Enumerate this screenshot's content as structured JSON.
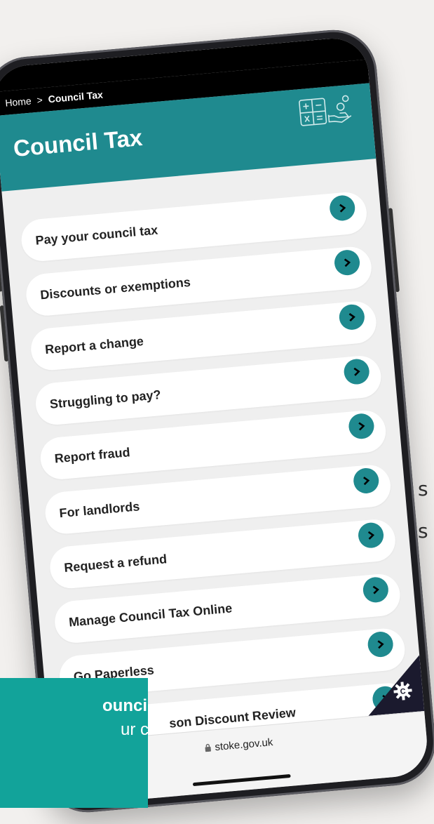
{
  "background_text": {
    "s1": "s",
    "s2": "s"
  },
  "breadcrumb": {
    "home": "Home",
    "separator": ">",
    "current": "Council Tax"
  },
  "header": {
    "title": "Council Tax",
    "icon": "calculator-hand-icon"
  },
  "menu": [
    {
      "label": "Pay your council tax"
    },
    {
      "label": "Discounts or exemptions"
    },
    {
      "label": "Report a change"
    },
    {
      "label": "Struggling to pay?"
    },
    {
      "label": "Report fraud"
    },
    {
      "label": "For landlords"
    },
    {
      "label": "Request a refund"
    },
    {
      "label": "Manage Council Tax Online"
    },
    {
      "label": "Go Paperless"
    },
    {
      "label": "son Discount Review"
    }
  ],
  "browser": {
    "url": "stoke.gov.uk",
    "lock_icon": "lock-icon"
  },
  "overlay": {
    "line1": "ounciltax",
    "line2": "ur council"
  },
  "colors": {
    "brand_teal": "#1f8a8f",
    "overlay_teal": "#12a39a",
    "corner_navy": "#1b1a2e"
  }
}
